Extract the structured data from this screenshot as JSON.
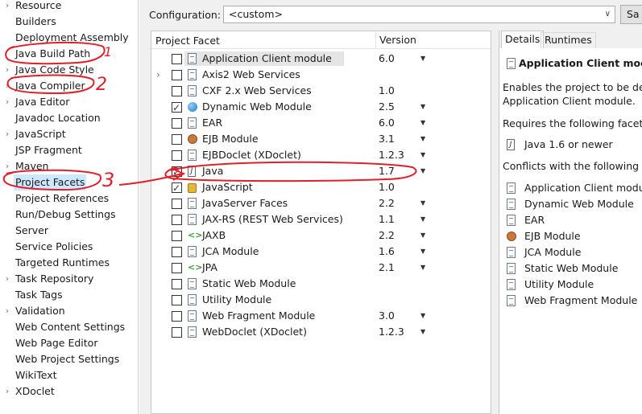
{
  "sidebar": {
    "items": [
      {
        "label": "Resource",
        "expandable": true,
        "selected": false
      },
      {
        "label": "Builders",
        "expandable": false,
        "selected": false
      },
      {
        "label": "Deployment Assembly",
        "expandable": false,
        "selected": false
      },
      {
        "label": "Java Build Path",
        "expandable": false,
        "selected": false
      },
      {
        "label": "Java Code Style",
        "expandable": true,
        "selected": false
      },
      {
        "label": "Java Compiler",
        "expandable": true,
        "selected": false
      },
      {
        "label": "Java Editor",
        "expandable": true,
        "selected": false
      },
      {
        "label": "Javadoc Location",
        "expandable": false,
        "selected": false
      },
      {
        "label": "JavaScript",
        "expandable": true,
        "selected": false
      },
      {
        "label": "JSP Fragment",
        "expandable": false,
        "selected": false
      },
      {
        "label": "Maven",
        "expandable": true,
        "selected": false
      },
      {
        "label": "Project Facets",
        "expandable": false,
        "selected": true
      },
      {
        "label": "Project References",
        "expandable": false,
        "selected": false
      },
      {
        "label": "Run/Debug Settings",
        "expandable": false,
        "selected": false
      },
      {
        "label": "Server",
        "expandable": false,
        "selected": false
      },
      {
        "label": "Service Policies",
        "expandable": false,
        "selected": false
      },
      {
        "label": "Targeted Runtimes",
        "expandable": false,
        "selected": false
      },
      {
        "label": "Task Repository",
        "expandable": true,
        "selected": false
      },
      {
        "label": "Task Tags",
        "expandable": false,
        "selected": false
      },
      {
        "label": "Validation",
        "expandable": true,
        "selected": false
      },
      {
        "label": "Web Content Settings",
        "expandable": false,
        "selected": false
      },
      {
        "label": "Web Page Editor",
        "expandable": false,
        "selected": false
      },
      {
        "label": "Web Project Settings",
        "expandable": false,
        "selected": false
      },
      {
        "label": "WikiText",
        "expandable": false,
        "selected": false
      },
      {
        "label": "XDoclet",
        "expandable": true,
        "selected": false
      }
    ]
  },
  "config": {
    "label": "Configuration:",
    "value": "<custom>",
    "save_label": "Sa"
  },
  "facets": {
    "col_facet": "Project Facet",
    "col_version": "Version",
    "rows": [
      {
        "name": "Application Client module",
        "version": "6.0",
        "checked": false,
        "icon": "file-icon",
        "expandable": false,
        "has_dropdown": true
      },
      {
        "name": "Axis2 Web Services",
        "version": "",
        "checked": false,
        "icon": "file-icon",
        "expandable": true,
        "has_dropdown": false
      },
      {
        "name": "CXF 2.x Web Services",
        "version": "1.0",
        "checked": false,
        "icon": "file-icon",
        "expandable": false,
        "has_dropdown": false
      },
      {
        "name": "Dynamic Web Module",
        "version": "2.5",
        "checked": true,
        "icon": "globe-icon",
        "expandable": false,
        "has_dropdown": true
      },
      {
        "name": "EAR",
        "version": "6.0",
        "checked": false,
        "icon": "file-icon",
        "expandable": false,
        "has_dropdown": true
      },
      {
        "name": "EJB Module",
        "version": "3.1",
        "checked": false,
        "icon": "bean-icon",
        "expandable": false,
        "has_dropdown": true
      },
      {
        "name": "EJBDoclet (XDoclet)",
        "version": "1.2.3",
        "checked": false,
        "icon": "file-icon",
        "expandable": false,
        "has_dropdown": true
      },
      {
        "name": "Java",
        "version": "1.7",
        "checked": true,
        "icon": "java-icon",
        "expandable": false,
        "has_dropdown": true
      },
      {
        "name": "JavaScript",
        "version": "1.0",
        "checked": true,
        "icon": "lock-icon",
        "expandable": false,
        "has_dropdown": false
      },
      {
        "name": "JavaServer Faces",
        "version": "2.2",
        "checked": false,
        "icon": "file-icon",
        "expandable": false,
        "has_dropdown": true
      },
      {
        "name": "JAX-RS (REST Web Services)",
        "version": "1.1",
        "checked": false,
        "icon": "file-icon",
        "expandable": false,
        "has_dropdown": true
      },
      {
        "name": "JAXB",
        "version": "2.2",
        "checked": false,
        "icon": "jaxb-icon",
        "expandable": false,
        "has_dropdown": true
      },
      {
        "name": "JCA Module",
        "version": "1.6",
        "checked": false,
        "icon": "file-icon",
        "expandable": false,
        "has_dropdown": true
      },
      {
        "name": "JPA",
        "version": "2.1",
        "checked": false,
        "icon": "jaxb-icon",
        "expandable": false,
        "has_dropdown": true
      },
      {
        "name": "Static Web Module",
        "version": "",
        "checked": false,
        "icon": "file-icon",
        "expandable": false,
        "has_dropdown": false
      },
      {
        "name": "Utility Module",
        "version": "",
        "checked": false,
        "icon": "file-icon",
        "expandable": false,
        "has_dropdown": false
      },
      {
        "name": "Web Fragment Module",
        "version": "3.0",
        "checked": false,
        "icon": "file-icon",
        "expandable": false,
        "has_dropdown": true
      },
      {
        "name": "WebDoclet (XDoclet)",
        "version": "1.2.3",
        "checked": false,
        "icon": "file-icon",
        "expandable": false,
        "has_dropdown": true
      }
    ]
  },
  "details": {
    "tabs": [
      {
        "label": "Details",
        "active": true
      },
      {
        "label": "Runtimes",
        "active": false
      }
    ],
    "title": "Application Client modul",
    "desc_line1": "Enables the project to be dep",
    "desc_line2": "Application Client module.",
    "requires_label": "Requires the following facet:",
    "requires": [
      {
        "label": "Java 1.6 or newer",
        "icon": "java-icon"
      }
    ],
    "conflicts_label": "Conflicts with the following fac",
    "conflicts": [
      {
        "label": "Application Client module",
        "icon": "file-icon"
      },
      {
        "label": "Dynamic Web Module",
        "icon": "file-icon"
      },
      {
        "label": "EAR",
        "icon": "file-icon"
      },
      {
        "label": "EJB Module",
        "icon": "bean-icon"
      },
      {
        "label": "JCA Module",
        "icon": "file-icon"
      },
      {
        "label": "Static Web Module",
        "icon": "file-icon"
      },
      {
        "label": "Utility Module",
        "icon": "file-icon"
      },
      {
        "label": "Web Fragment Module",
        "icon": "file-icon"
      }
    ]
  },
  "annotations": {
    "color": "#e0202a",
    "numbers": [
      "1",
      "2",
      "3"
    ]
  }
}
